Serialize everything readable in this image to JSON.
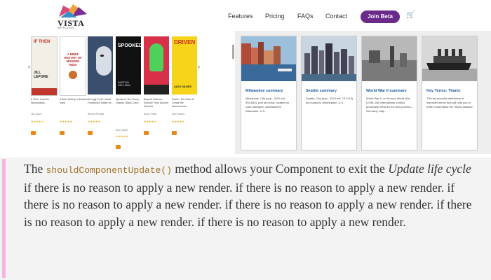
{
  "nav": {
    "logo_word": "VISTA",
    "logo_sub": "WP PLUGIN",
    "links": [
      "Features",
      "Pricing",
      "FAQs",
      "Contact"
    ],
    "join_label": "Join Beta",
    "cart_icon": "cart-icon",
    "brand_color": "#6a2a8a"
  },
  "books": [
    {
      "cover_text": "IF THEN",
      "author_tag": "JILL LEPORE",
      "title": "If Then: How the Simulmatics...",
      "author": "Jill Lepore",
      "stars": "★★★★½"
    },
    {
      "cover_text": "A BRIEF HISTORY OF MODERN INDIA",
      "author_tag": "",
      "title": "A Brief History of Modern India",
      "author": "",
      "stars": "★★★★★"
    },
    {
      "cover_text": "",
      "author_tag": "",
      "title": "An Ugly Truth: Inside Facebook's Battle for...",
      "author": "Sheera Frenkel",
      "stars": "★★★★★"
    },
    {
      "cover_text": "SPOOKED",
      "author_tag": "BARTON GELLMAN",
      "title": "Spooked: The Trump Dossier, Black Cube...",
      "author": "Barry Meier",
      "stars": "★★★★★"
    },
    {
      "cover_text": "",
      "author_tag": "",
      "title": "Beyond Science: Science From Ancient Sources",
      "author": "Ankur Fresh",
      "stars": "★★★★½"
    },
    {
      "cover_text": "DRIVEN",
      "author_tag": "ALEX DAVIES",
      "title": "Driven: The Race to Create the Autonomous...",
      "author": "Alex Davies",
      "stars": "★★★★★"
    }
  ],
  "cards": [
    {
      "title": "Milwaukee summary",
      "text": "Milwaukee, City (pop., 2020 est. 594,833), port and seat, located on Lake Michigan, southeastern Wisconsin, U.S."
    },
    {
      "title": "Seattle summary",
      "text": "Seattle, City (pop., 2020 est. 737,015) and seaport, Washington, U.S."
    },
    {
      "title": "World War II summary",
      "text": "World War II, or Second World War, (1939–45) International conflict principally between the Axis powers—Germany, Italy..."
    },
    {
      "title": "Key Terms: Titanic",
      "text": "This list provides definitions of important terms that will help you to better understand the Titanic disaster."
    }
  ],
  "quote": {
    "the": "The",
    "code": "shouldComponentUpdate()",
    "p1": "method allows your Component to exit the",
    "em": "Update life cycle",
    "p2": "if there is no reason to apply a new render. if there is no reason to apply a new render. if there is no reason to apply a new render. if there is no reason to apply a new render. if there is no reason to apply a new render. if there is no reason to apply a new render."
  }
}
